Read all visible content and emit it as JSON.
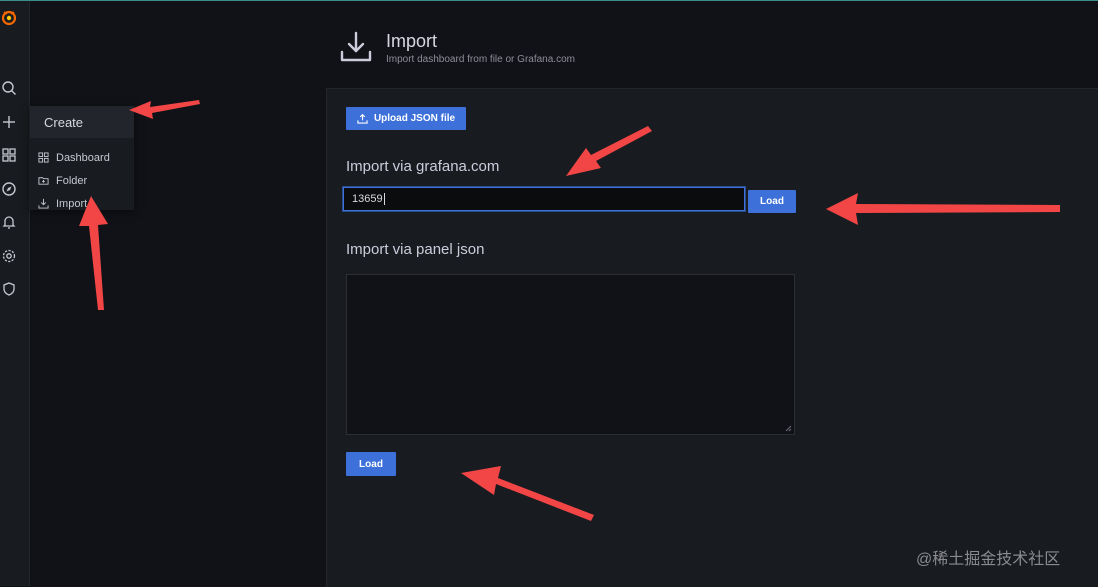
{
  "header": {
    "title": "Import",
    "subtitle": "Import dashboard from file or Grafana.com"
  },
  "create_menu": {
    "header": "Create",
    "items": [
      {
        "label": "Dashboard",
        "icon": "apps-icon"
      },
      {
        "label": "Folder",
        "icon": "folder-plus-icon"
      },
      {
        "label": "Import",
        "icon": "import-icon"
      }
    ]
  },
  "upload": {
    "label": "Upload JSON file"
  },
  "grafana_com": {
    "heading": "Import via grafana.com",
    "value": "13659",
    "load_label": "Load"
  },
  "panel_json": {
    "heading": "Import via panel json",
    "value": "",
    "load_label": "Load"
  },
  "watermark": "@稀土掘金技术社区",
  "colors": {
    "primary": "#3d71d9",
    "background": "#111217",
    "panel": "#181b1f",
    "arrow": "#f24646",
    "logo": "#f46800"
  }
}
